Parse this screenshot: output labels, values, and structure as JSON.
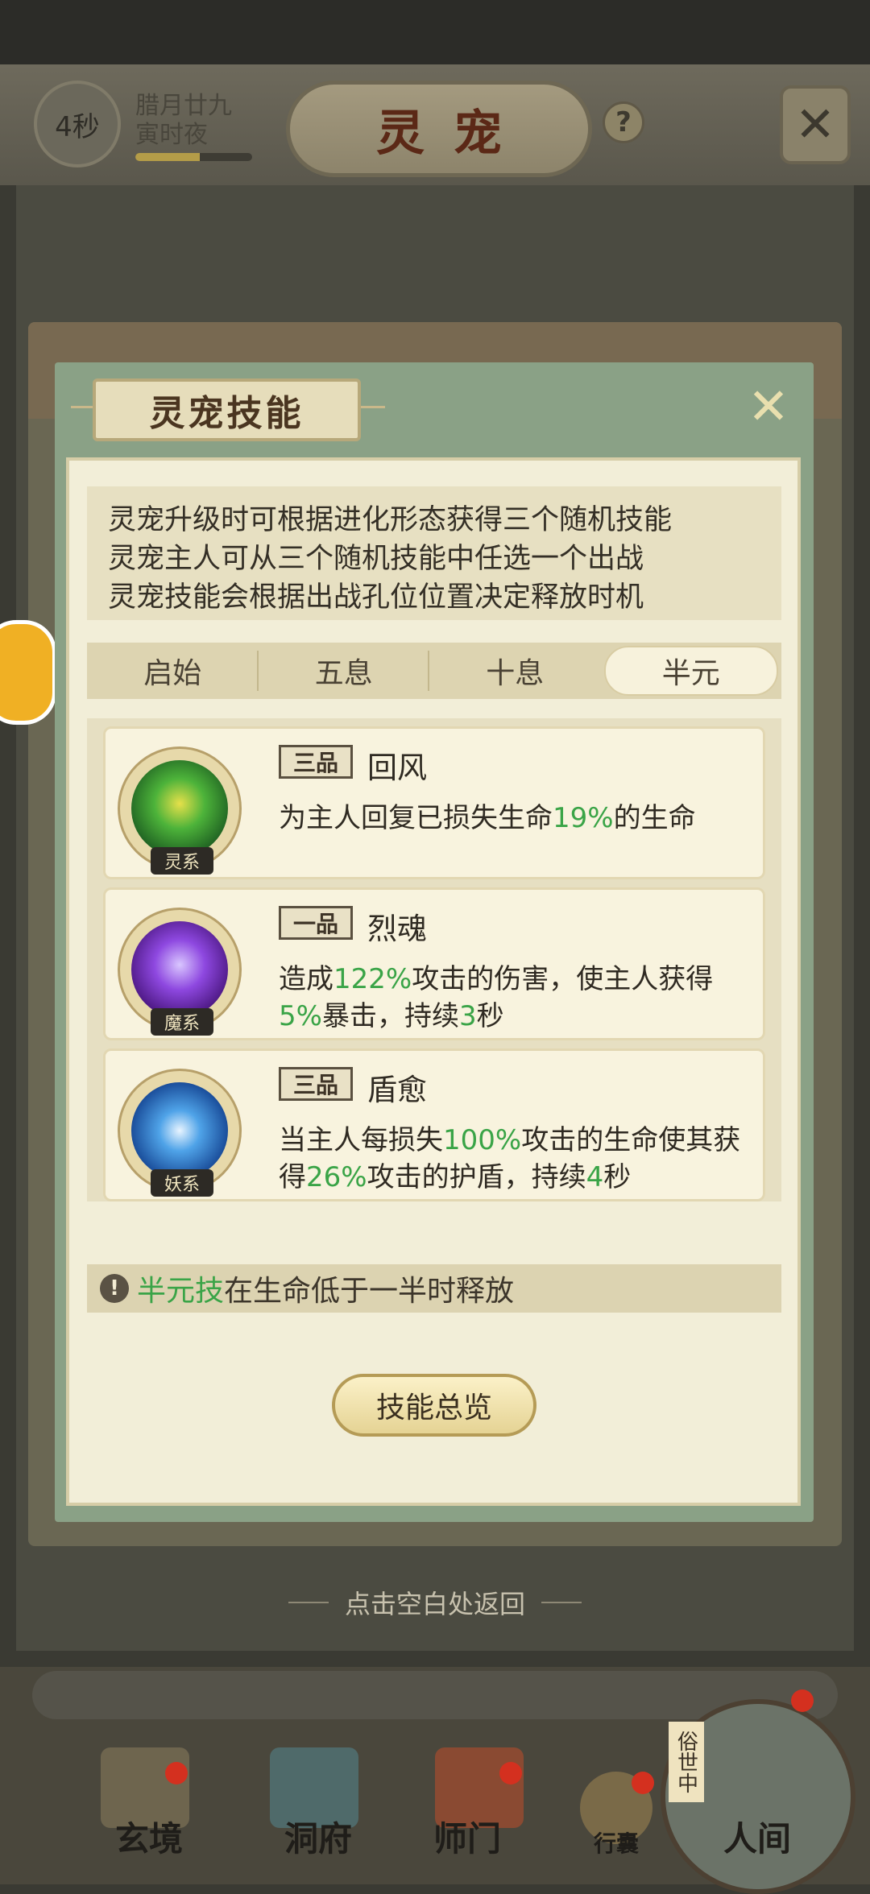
{
  "header": {
    "timer": "4秒",
    "date_line1": "腊月廿九",
    "date_line2": "寅时夜",
    "date_progress": 0.55,
    "title": "灵宠",
    "help_icon": "?",
    "close_icon": "✕"
  },
  "dialog": {
    "title": "灵宠技能",
    "close_icon": "✕",
    "intro": [
      "灵宠升级时可根据进化形态获得三个随机技能",
      "灵宠主人可从三个随机技能中任选一个出战",
      "灵宠技能会根据出战孔位位置决定释放时机"
    ],
    "tabs": [
      "启始",
      "五息",
      "十息",
      "半元"
    ],
    "active_tab": 3,
    "skills": [
      {
        "grade": "三品",
        "name": "回风",
        "element": "灵系",
        "desc_parts": [
          "为主人回复已损失生命",
          "19%",
          "的生命"
        ]
      },
      {
        "grade": "一品",
        "name": "烈魂",
        "element": "魔系",
        "desc_parts": [
          "造成",
          "122%",
          "攻击的伤害，使主人获得",
          "5%",
          "暴击，持续",
          "3",
          "秒"
        ]
      },
      {
        "grade": "三品",
        "name": "盾愈",
        "element": "妖系",
        "desc_parts": [
          "当主人每损失",
          "100%",
          "攻击的生命使其获得",
          "26%",
          "攻击的护盾，持续",
          "4",
          "秒"
        ]
      }
    ],
    "tip": {
      "icon": "!",
      "highlight": "半元技",
      "text": "在生命低于一半时释放"
    },
    "overview_button": "技能总览"
  },
  "back_hint": "点击空白处返回",
  "bottom_nav": {
    "items": [
      "玄境",
      "洞府",
      "师门",
      "行囊",
      "人间"
    ],
    "world_label": "俗世中"
  },
  "colors": {
    "highlight_green": "#3aa447",
    "badge_red": "#d4301f"
  }
}
